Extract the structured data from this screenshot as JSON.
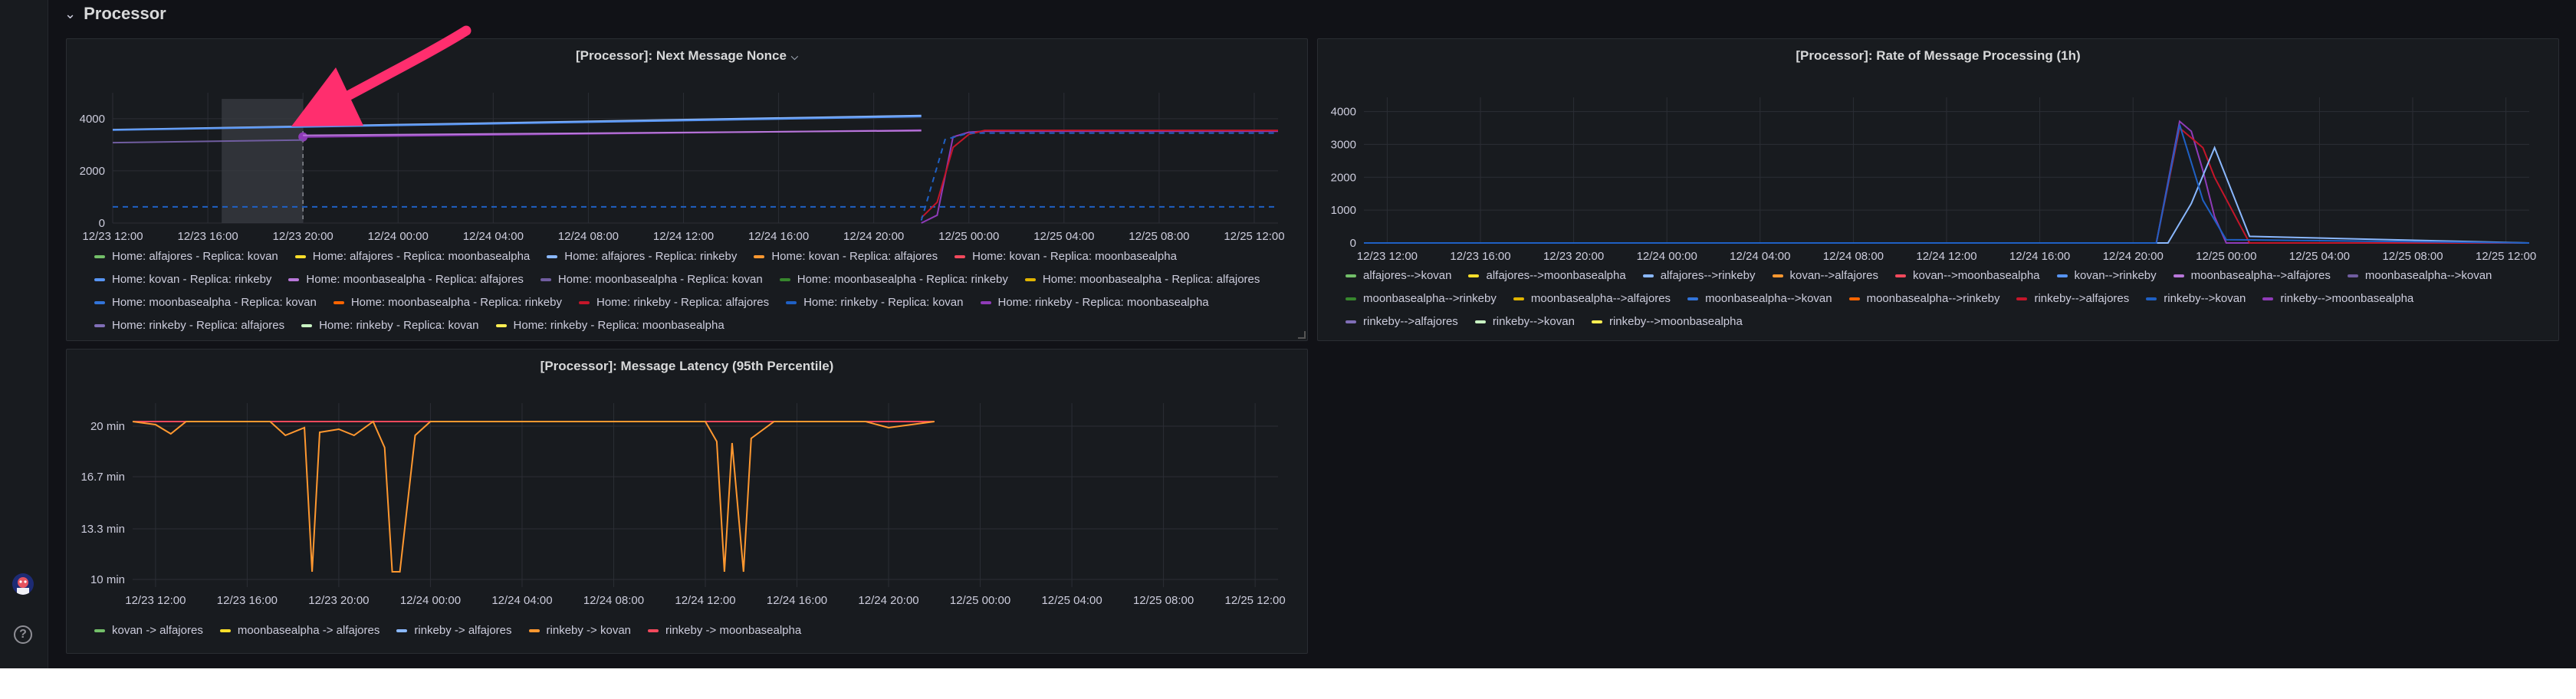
{
  "row": {
    "title": "Processor"
  },
  "help_glyph": "?",
  "panels": {
    "nonce": {
      "title": "[Processor]: Next Message Nonce",
      "y_ticks": [
        "4000",
        "2000",
        "0"
      ],
      "x_ticks": [
        "12/23 12:00",
        "12/23 16:00",
        "12/23 20:00",
        "12/24 00:00",
        "12/24 04:00",
        "12/24 08:00",
        "12/24 12:00",
        "12/24 16:00",
        "12/24 20:00",
        "12/25 00:00",
        "12/25 04:00",
        "12/25 08:00",
        "12/25 12:00"
      ],
      "legend": [
        {
          "label": "Home: alfajores - Replica: kovan",
          "color": "#73bf69"
        },
        {
          "label": "Home: alfajores - Replica: moonbasealpha",
          "color": "#fade2a"
        },
        {
          "label": "Home: alfajores - Replica: rinkeby",
          "color": "#8ab8ff"
        },
        {
          "label": "Home: kovan - Replica: alfajores",
          "color": "#ff9830"
        },
        {
          "label": "Home: kovan - Replica: moonbasealpha",
          "color": "#f2495c"
        },
        {
          "label": "Home: kovan - Replica: rinkeby",
          "color": "#5794f2"
        },
        {
          "label": "Home: moonbasealpha - Replica: alfajores",
          "color": "#b877d9"
        },
        {
          "label": "Home: moonbasealpha - Replica: kovan",
          "color": "#705da0"
        },
        {
          "label": "Home: moonbasealpha - Replica: rinkeby",
          "color": "#37872d"
        },
        {
          "label": "Home: moonbasealpha - Replica: alfajores",
          "color": "#e0b400"
        },
        {
          "label": "Home: moonbasealpha - Replica: kovan",
          "color": "#3274d9"
        },
        {
          "label": "Home: moonbasealpha - Replica: rinkeby",
          "color": "#fa6400"
        },
        {
          "label": "Home: rinkeby - Replica: alfajores",
          "color": "#c4162a"
        },
        {
          "label": "Home: rinkeby - Replica: kovan",
          "color": "#1f60c4"
        },
        {
          "label": "Home: rinkeby - Replica: moonbasealpha",
          "color": "#8f3bb8"
        },
        {
          "label": "Home: rinkeby - Replica: alfajores",
          "color": "#806eb7"
        },
        {
          "label": "Home: rinkeby - Replica: kovan",
          "color": "#c8f2c2"
        },
        {
          "label": "Home: rinkeby - Replica: moonbasealpha",
          "color": "#ffee52"
        }
      ]
    },
    "rate": {
      "title": "[Processor]: Rate of Message Processing (1h)",
      "y_ticks": [
        "4000",
        "3000",
        "2000",
        "1000",
        "0"
      ],
      "x_ticks": [
        "12/23 12:00",
        "12/23 16:00",
        "12/23 20:00",
        "12/24 00:00",
        "12/24 04:00",
        "12/24 08:00",
        "12/24 12:00",
        "12/24 16:00",
        "12/24 20:00",
        "12/25 00:00",
        "12/25 04:00",
        "12/25 08:00",
        "12/25 12:00"
      ],
      "legend": [
        {
          "label": "alfajores-->kovan",
          "color": "#73bf69"
        },
        {
          "label": "alfajores-->moonbasealpha",
          "color": "#fade2a"
        },
        {
          "label": "alfajores-->rinkeby",
          "color": "#8ab8ff"
        },
        {
          "label": "kovan-->alfajores",
          "color": "#ff9830"
        },
        {
          "label": "kovan-->moonbasealpha",
          "color": "#f2495c"
        },
        {
          "label": "kovan-->rinkeby",
          "color": "#5794f2"
        },
        {
          "label": "moonbasealpha-->alfajores",
          "color": "#b877d9"
        },
        {
          "label": "moonbasealpha-->kovan",
          "color": "#705da0"
        },
        {
          "label": "moonbasealpha-->rinkeby",
          "color": "#37872d"
        },
        {
          "label": "moonbasealpha-->alfajores",
          "color": "#e0b400"
        },
        {
          "label": "moonbasealpha-->kovan",
          "color": "#3274d9"
        },
        {
          "label": "moonbasealpha-->rinkeby",
          "color": "#fa6400"
        },
        {
          "label": "rinkeby-->alfajores",
          "color": "#c4162a"
        },
        {
          "label": "rinkeby-->kovan",
          "color": "#1f60c4"
        },
        {
          "label": "rinkeby-->moonbasealpha",
          "color": "#8f3bb8"
        },
        {
          "label": "rinkeby-->alfajores",
          "color": "#806eb7"
        },
        {
          "label": "rinkeby-->kovan",
          "color": "#c8f2c2"
        },
        {
          "label": "rinkeby-->moonbasealpha",
          "color": "#ffee52"
        }
      ]
    },
    "latency": {
      "title": "[Processor]: Message Latency (95th Percentile)",
      "y_ticks": [
        "20 min",
        "16.7 min",
        "13.3 min",
        "10 min"
      ],
      "x_ticks": [
        "12/23 12:00",
        "12/23 16:00",
        "12/23 20:00",
        "12/24 00:00",
        "12/24 04:00",
        "12/24 08:00",
        "12/24 12:00",
        "12/24 16:00",
        "12/24 20:00",
        "12/25 00:00",
        "12/25 04:00",
        "12/25 08:00",
        "12/25 12:00"
      ],
      "legend": [
        {
          "label": "kovan -> alfajores",
          "color": "#73bf69"
        },
        {
          "label": "moonbasealpha -> alfajores",
          "color": "#fade2a"
        },
        {
          "label": "rinkeby -> alfajores",
          "color": "#8ab8ff"
        },
        {
          "label": "rinkeby -> kovan",
          "color": "#ff9830"
        },
        {
          "label": "rinkeby -> moonbasealpha",
          "color": "#f2495c"
        }
      ]
    }
  },
  "chart_data": [
    {
      "type": "line",
      "title": "[Processor]: Next Message Nonce",
      "x_range": [
        "12/23 12:00",
        "12/25 13:00"
      ],
      "ylim": [
        0,
        4700
      ],
      "grid": true,
      "legend_placement": "bottom",
      "series": [
        {
          "name": "Home: alfajores - Replica: rinkeby",
          "x": [
            "12/23 12:00",
            "12/24 22:00"
          ],
          "values": [
            3580,
            4120
          ]
        },
        {
          "name": "Home: kovan - Replica: rinkeby",
          "x": [
            "12/23 12:00",
            "12/24 22:00"
          ],
          "values": [
            3560,
            4080
          ]
        },
        {
          "name": "Home: moonbasealpha - Replica: kovan",
          "x": [
            "12/23 12:00",
            "12/23 20:00"
          ],
          "values": [
            3080,
            3180
          ]
        },
        {
          "name": "Home: rinkeby - Replica: moonbasealpha",
          "x": [
            "12/23 20:00",
            "12/24 22:00"
          ],
          "values": [
            3300,
            3560
          ]
        },
        {
          "name": "Home: moonbasealpha - Replica: alfajores",
          "x": [
            "12/23 20:00",
            "12/24 22:00"
          ],
          "values": [
            3360,
            3540
          ]
        },
        {
          "name": "Home: rinkeby - Replica: kovan",
          "x": [
            "12/23 12:00",
            "12/25 13:00"
          ],
          "values": [
            620,
            620
          ]
        },
        {
          "name": "Home: rinkeby - Replica: moonbasealpha",
          "x": [
            "12/24 22:00",
            "12/24 22:40",
            "12/24 23:20",
            "12/25 00:00",
            "12/25 00:40",
            "12/25 13:00"
          ],
          "values": [
            0,
            300,
            3300,
            3480,
            3520,
            3520
          ]
        },
        {
          "name": "Home: rinkeby - Replica: alfajores",
          "x": [
            "12/24 22:00",
            "12/24 22:40",
            "12/24 23:20",
            "12/25 00:00",
            "12/25 00:40",
            "12/25 13:00"
          ],
          "values": [
            200,
            800,
            2900,
            3400,
            3550,
            3550
          ]
        },
        {
          "name": "Home: rinkeby - Replica: kovan",
          "x": [
            "12/24 22:00",
            "12/24 23:00",
            "12/25 00:00",
            "12/25 13:00"
          ],
          "values": [
            100,
            3200,
            3450,
            3450
          ]
        }
      ]
    },
    {
      "type": "line",
      "title": "[Processor]: Rate of Message Processing (1h)",
      "x_range": [
        "12/23 11:00",
        "12/25 13:00"
      ],
      "ylim": [
        0,
        4200
      ],
      "grid": true,
      "legend_placement": "bottom",
      "series": [
        {
          "name": "rinkeby-->moonbasealpha",
          "x": [
            "12/23 11:00",
            "12/24 21:00",
            "12/24 22:00",
            "12/24 22:30",
            "12/24 23:00",
            "12/24 23:30",
            "12/25 00:00",
            "12/25 13:00"
          ],
          "values": [
            0,
            0,
            3700,
            3400,
            2200,
            800,
            0,
            0
          ]
        },
        {
          "name": "rinkeby-->alfajores",
          "x": [
            "12/23 11:00",
            "12/24 21:00",
            "12/24 22:00",
            "12/24 22:30",
            "12/24 23:00",
            "12/24 23:30",
            "12/25 01:00",
            "12/25 13:00"
          ],
          "values": [
            0,
            0,
            3500,
            3200,
            2900,
            2000,
            0,
            0
          ]
        },
        {
          "name": "alfajores-->rinkeby",
          "x": [
            "12/23 11:00",
            "12/24 21:30",
            "12/24 22:30",
            "12/24 23:30",
            "12/25 01:00",
            "12/25 13:00"
          ],
          "values": [
            0,
            0,
            1200,
            2900,
            200,
            0
          ]
        },
        {
          "name": "rinkeby-->kovan",
          "x": [
            "12/23 11:00",
            "12/24 21:00",
            "12/24 22:00",
            "12/24 23:00",
            "12/25 00:00",
            "12/25 13:00"
          ],
          "values": [
            0,
            0,
            3600,
            1300,
            100,
            0
          ]
        }
      ]
    },
    {
      "type": "line",
      "title": "[Processor]: Message Latency (95th Percentile)",
      "x_range": [
        "12/23 11:00",
        "12/25 13:00"
      ],
      "ylim": [
        "9.5 min",
        "21 min"
      ],
      "y_values_in_minutes": true,
      "grid": true,
      "legend_placement": "bottom",
      "series": [
        {
          "name": "rinkeby -> moonbasealpha",
          "x": [
            "12/23 11:00",
            "12/24 22:00"
          ],
          "values": [
            20.3,
            20.3
          ]
        },
        {
          "name": "rinkeby -> kovan",
          "x": [
            "12/23 11:00",
            "12/23 12:00",
            "12/23 12:40",
            "12/23 13:20",
            "12/23 17:00",
            "12/23 17:40",
            "12/23 18:30",
            "12/23 18:50",
            "12/23 19:10",
            "12/23 20:00",
            "12/23 20:40",
            "12/23 21:30",
            "12/23 22:00",
            "12/23 22:20",
            "12/23 22:40",
            "12/23 23:20",
            "12/24 00:00",
            "12/24 12:00",
            "12/24 12:30",
            "12/24 12:50",
            "12/24 13:10",
            "12/24 13:40",
            "12/24 14:00",
            "12/24 15:00",
            "12/24 19:00",
            "12/24 20:00",
            "12/24 22:00"
          ],
          "values": [
            20.3,
            20.1,
            19.5,
            20.3,
            20.3,
            19.4,
            19.9,
            10.5,
            19.6,
            19.8,
            19.4,
            20.3,
            18.6,
            10.5,
            10.5,
            19.4,
            20.3,
            20.3,
            19.0,
            10.5,
            18.9,
            10.5,
            19.2,
            20.3,
            20.3,
            19.9,
            20.3
          ]
        }
      ]
    }
  ]
}
